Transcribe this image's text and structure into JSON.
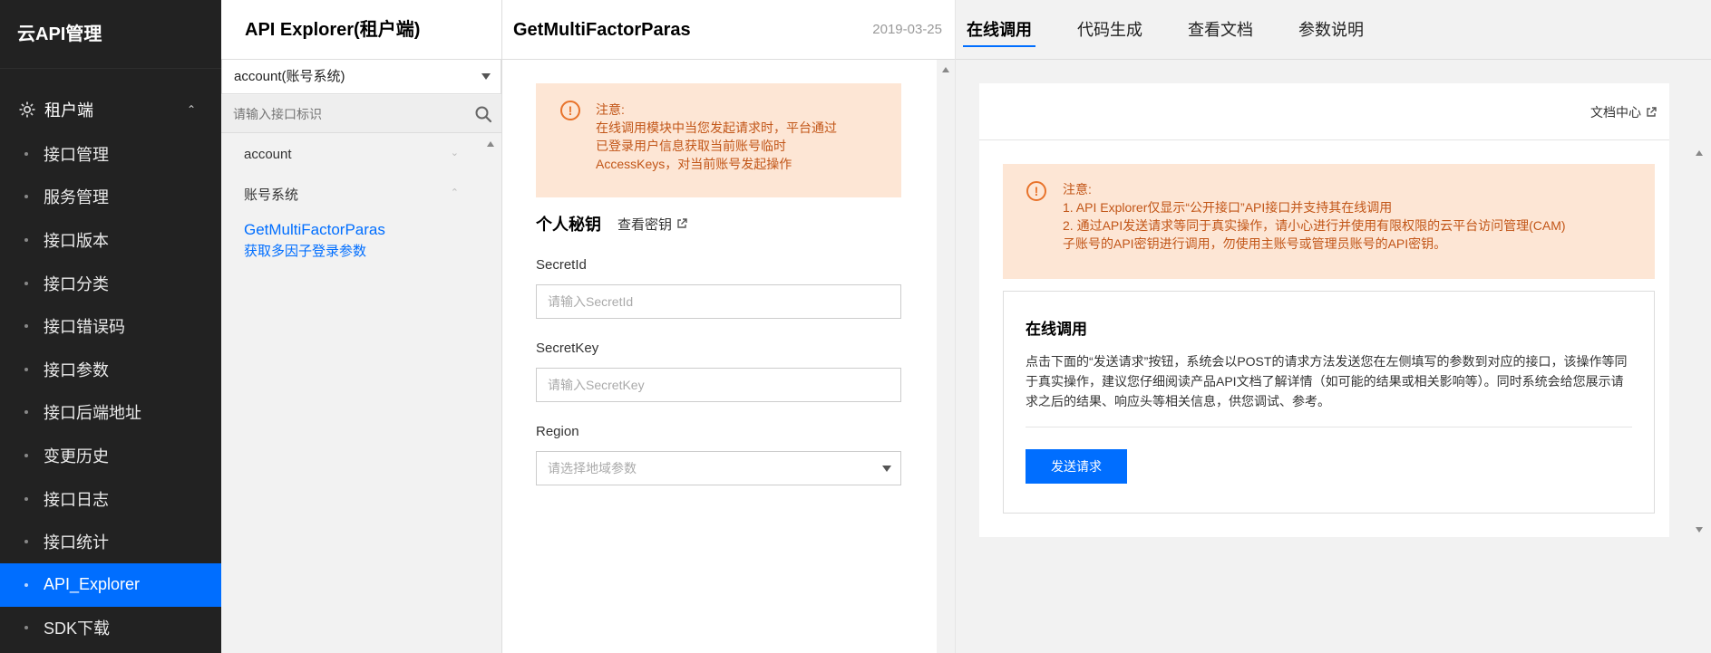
{
  "sidebar": {
    "brand": "云API管理",
    "group": {
      "label": "租户端",
      "icon": "cog-icon"
    },
    "items": [
      {
        "label": "接口管理"
      },
      {
        "label": "服务管理"
      },
      {
        "label": "接口版本"
      },
      {
        "label": "接口分类"
      },
      {
        "label": "接口错误码"
      },
      {
        "label": "接口参数"
      },
      {
        "label": "接口后端地址"
      },
      {
        "label": "变更历史"
      },
      {
        "label": "接口日志"
      },
      {
        "label": "接口统计"
      },
      {
        "label": "API_Explorer",
        "active": true
      },
      {
        "label": "SDK下载"
      }
    ]
  },
  "api_list": {
    "title": "API Explorer(租户端)",
    "product_select": "account(账号系统)",
    "search_placeholder": "请输入接口标识",
    "tree": {
      "service": "account",
      "category": "账号系统",
      "action": {
        "name": "GetMultiFactorParas",
        "desc": "获取多因子登录参数"
      }
    }
  },
  "params": {
    "action_name": "GetMultiFactorParas",
    "date": "2019-03-25",
    "notice": {
      "title": "注意:",
      "lines": [
        "在线调用模块中当您发起请求时，平台通过",
        "已登录用户信息获取当前账号临时",
        "AccessKeys，对当前账号发起操作"
      ]
    },
    "section_title": "个人秘钥",
    "view_key_link": "查看密钥",
    "secret_id": {
      "label": "SecretId",
      "placeholder": "请输入SecretId"
    },
    "secret_key": {
      "label": "SecretKey",
      "placeholder": "请输入SecretKey"
    },
    "region": {
      "label": "Region",
      "placeholder": "请选择地域参数"
    }
  },
  "docs": {
    "tabs": [
      {
        "label": "在线调用",
        "active": true
      },
      {
        "label": "代码生成"
      },
      {
        "label": "查看文档"
      },
      {
        "label": "参数说明"
      }
    ],
    "doc_center": "文档中心",
    "notice": {
      "title": "注意:",
      "lines": [
        "1. API Explorer仅显示“公开接口”API接口并支持其在线调用",
        "2. 通过API发送请求等同于真实操作，请小心进行并使用有限权限的云平台访问管理(CAM)",
        "子账号的API密钥进行调用，勿使用主账号或管理员账号的API密钥。"
      ]
    },
    "online": {
      "title": "在线调用",
      "desc": "点击下面的“发送请求”按钮，系统会以POST的请求方法发送您在左侧填写的参数到对应的接口，该操作等同于真实操作，建议您仔细阅读产品API文档了解详情（如可能的结果或相关影响等）。同时系统会给您展示请求之后的结果、响应头等相关信息，供您调试、参考。",
      "send_button": "发送请求"
    }
  },
  "colors": {
    "accent": "#006eff",
    "sidebar_bg": "#222222",
    "notice_bg": "#fde6d5",
    "notice_text": "#c25618"
  }
}
